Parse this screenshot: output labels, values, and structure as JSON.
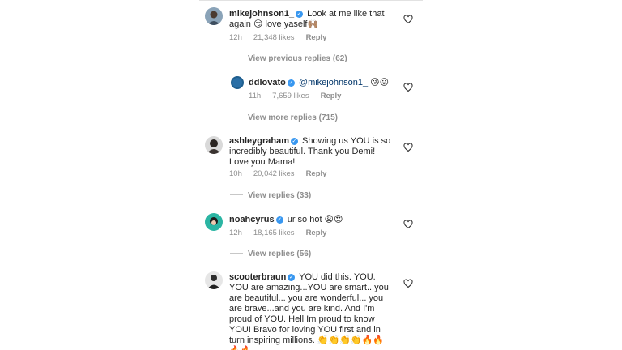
{
  "comments": [
    {
      "username": "mikejohnson1_",
      "text": "Look at me like that again 😏 love yaself🙌🏽",
      "time": "12h",
      "likes": "21,348 likes",
      "reply_label": "Reply"
    },
    {
      "username": "ddlovato",
      "mention": "@mikejohnson1_",
      "text": "😘😛",
      "time": "11h",
      "likes": "7,659 likes",
      "reply_label": "Reply"
    },
    {
      "username": "ashleygraham",
      "text": "Showing us YOU is so incredibly beautiful. Thank you Demi! Love you Mama!",
      "time": "10h",
      "likes": "20,042 likes",
      "reply_label": "Reply"
    },
    {
      "username": "noahcyrus",
      "text": "ur so hot 😩😍",
      "time": "12h",
      "likes": "18,165 likes",
      "reply_label": "Reply"
    },
    {
      "username": "scooterbraun",
      "text": "YOU did this. YOU. YOU are amazing...YOU are smart...you are beautiful... you are wonderful... you are brave...and you are kind. And I'm proud of YOU. Hell Im proud to know YOU! Bravo for loving YOU first and in turn inspiring millions. 👏👏👏👏🔥🔥🔥🔥"
    }
  ],
  "threads": {
    "previous_replies": "View previous replies (62)",
    "more_replies": "View more replies (715)",
    "replies_ashley": "View replies (33)",
    "replies_noah": "View replies (56)"
  },
  "colors": {
    "verified": "#3897f0",
    "meta_gray": "#8e8e8e",
    "mention": "#003569"
  }
}
